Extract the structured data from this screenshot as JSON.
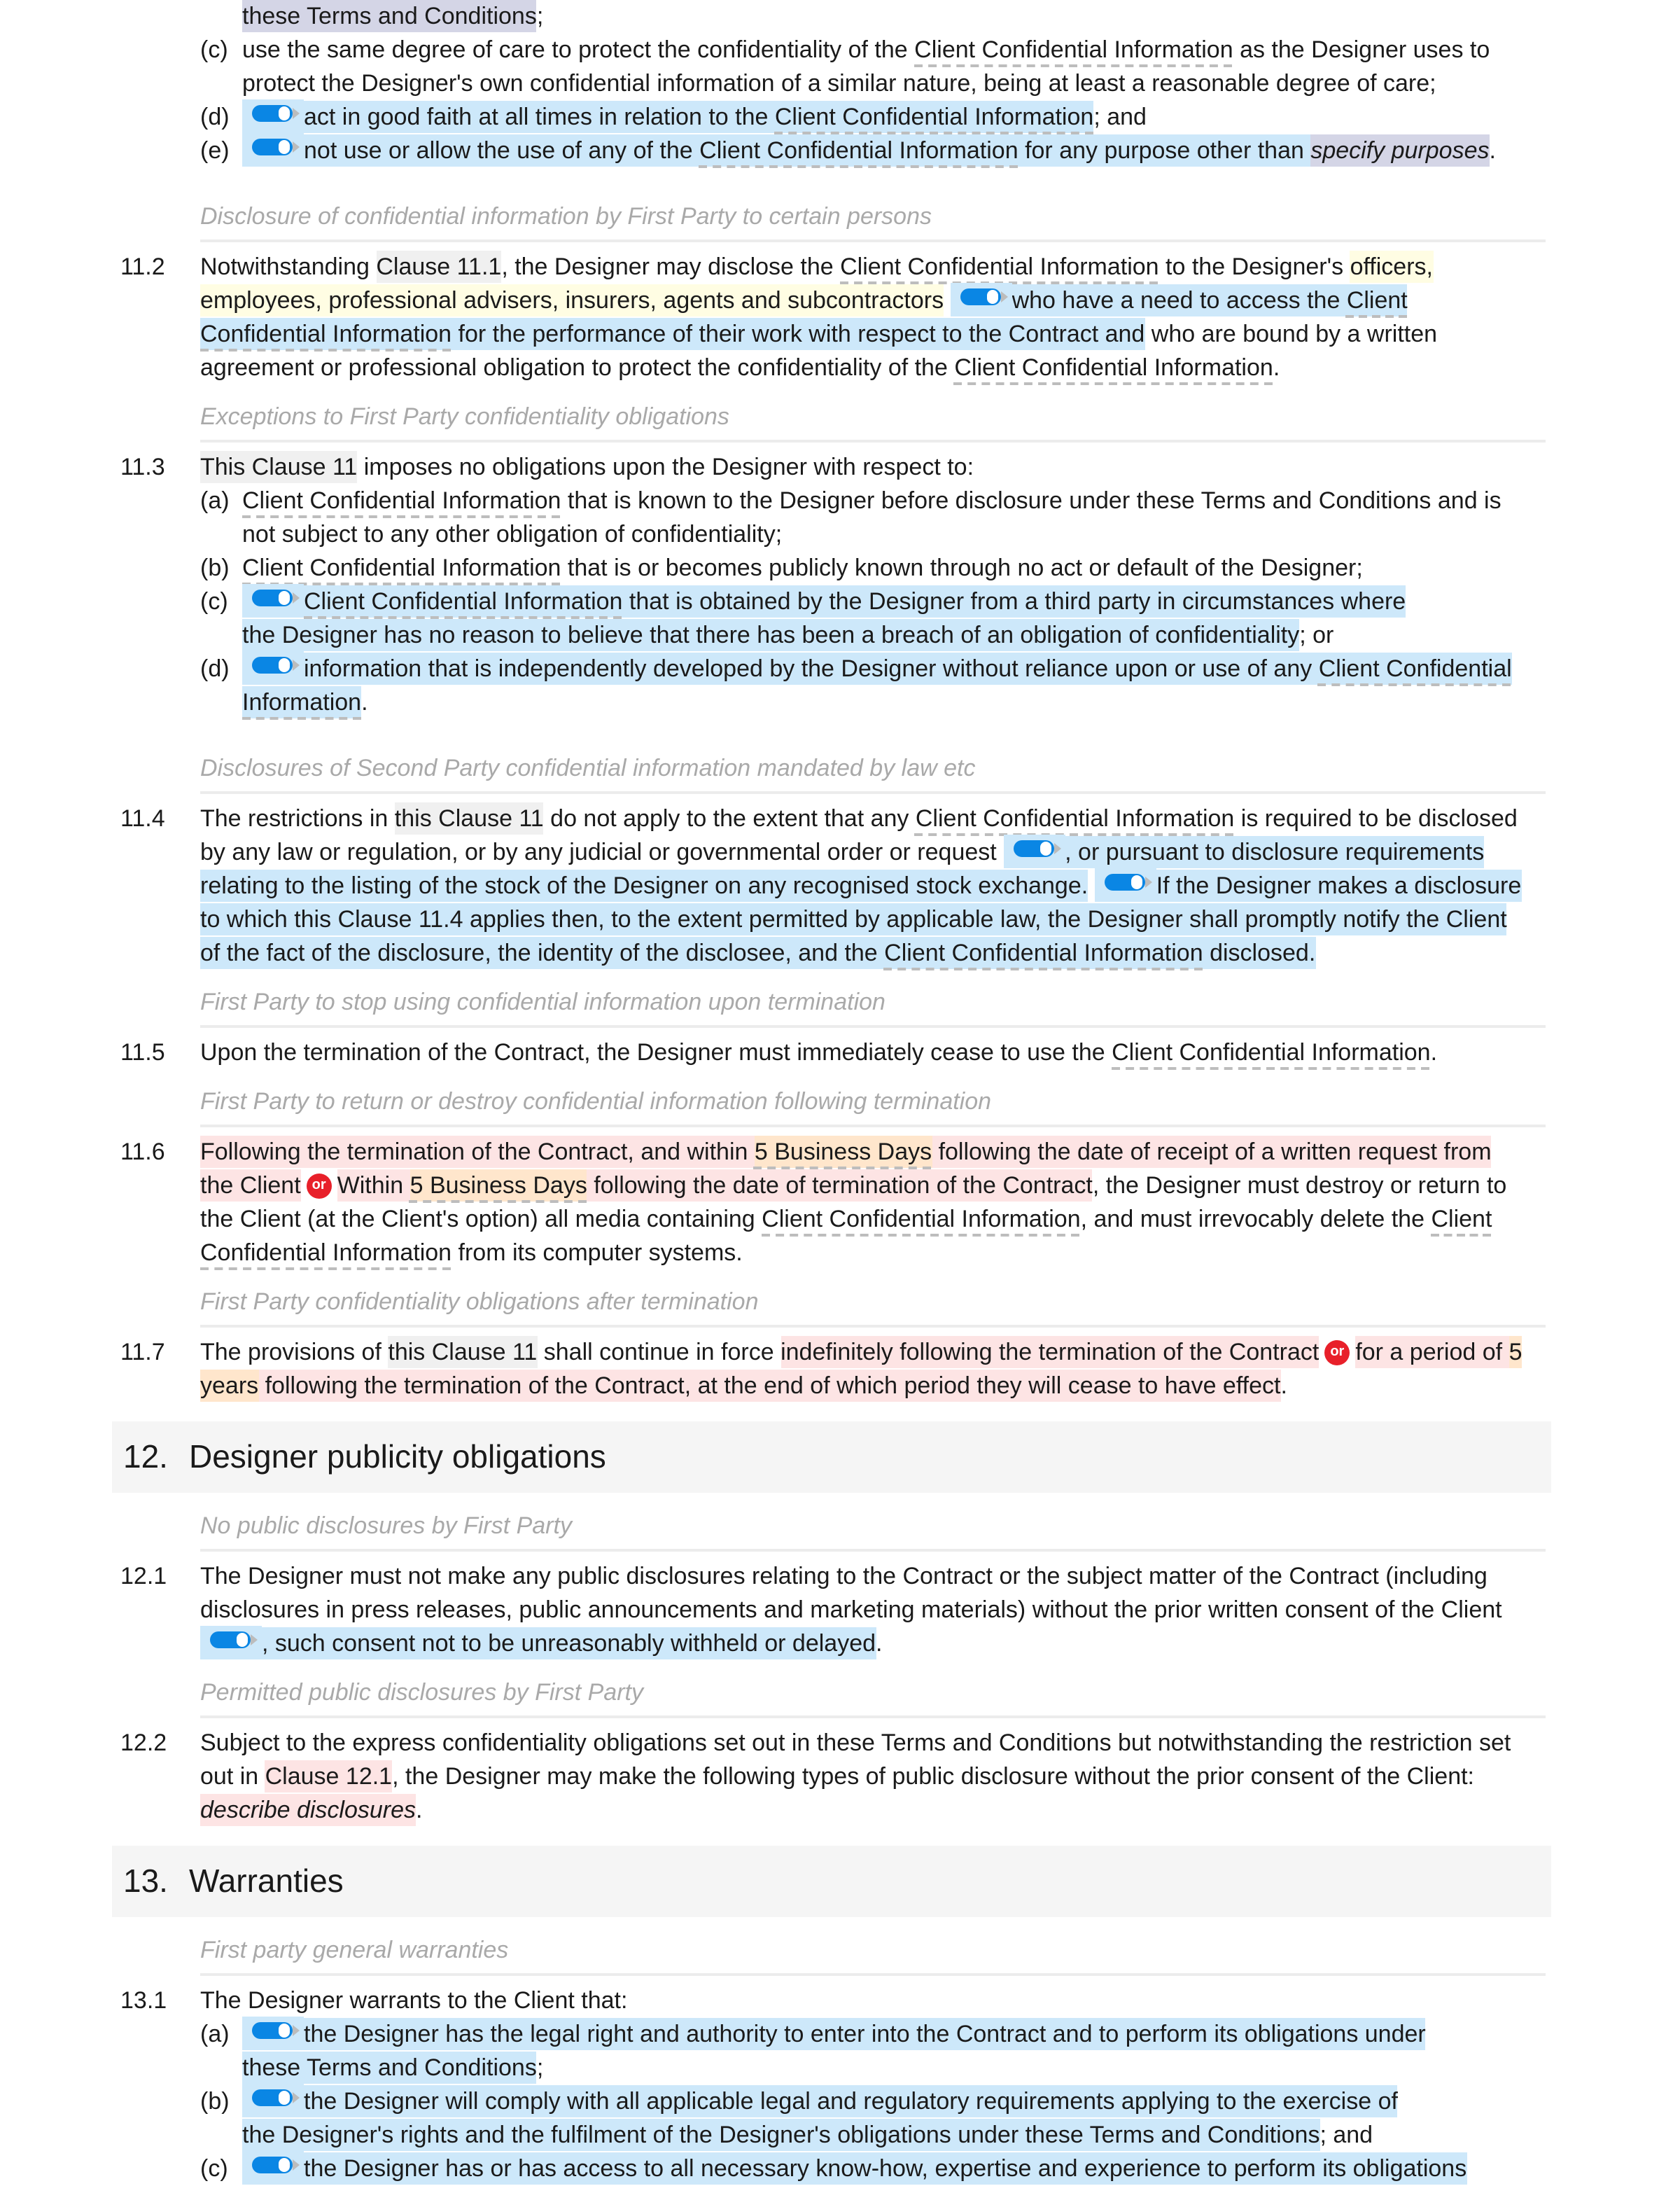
{
  "colors": {
    "toggle": "#0a86e4",
    "option_highlight": "#cde8fa",
    "alternative_highlight": "#fde4e4",
    "variable_highlight": "#ffe6cc",
    "or_badge": "#e8202a"
  },
  "blocks": [
    {
      "type": "sub",
      "label": "",
      "lines": [
        [
          {
            "t": "these Terms and Conditions",
            "c": "v"
          },
          {
            "t": ";"
          }
        ]
      ]
    },
    {
      "type": "sub",
      "label": "(c)",
      "lines": [
        [
          {
            "t": "use the same degree of care to protect the confidentiality of the "
          },
          {
            "t": "Client Confidential Information",
            "c": "d"
          },
          {
            "t": " as the Designer uses to"
          }
        ],
        [
          {
            "t": "protect the Designer's own confidential information of a similar nature, being at least a reasonable degree of care;"
          }
        ]
      ]
    },
    {
      "type": "sub",
      "label": "(d)",
      "lines": [
        [
          {
            "i": "toggle",
            "c": "b"
          },
          {
            "t": "act in good faith at all times in relation to the ",
            "c": "b"
          },
          {
            "t": "Client Confidential Information",
            "c": "b d"
          },
          {
            "t": "; and"
          }
        ]
      ]
    },
    {
      "type": "sub",
      "label": "(e)",
      "lines": [
        [
          {
            "i": "toggle",
            "c": "b"
          },
          {
            "t": "not use or allow the use of any of the ",
            "c": "b"
          },
          {
            "t": "Client Confidential Information",
            "c": "b d"
          },
          {
            "t": " for any purpose other than ",
            "c": "b"
          },
          {
            "t": "specify purposes",
            "c": "v i"
          },
          {
            "t": "."
          }
        ]
      ]
    },
    {
      "type": "heading",
      "text": "Disclosure of confidential information by First Party to certain persons"
    },
    {
      "type": "clause",
      "num": "11.2",
      "lines": [
        [
          {
            "t": "Notwithstanding "
          },
          {
            "t": "Clause 11.1",
            "c": "g"
          },
          {
            "t": ", the Designer may disclose the "
          },
          {
            "t": "Client Confidential Information",
            "c": "d"
          },
          {
            "t": " to the Designer's "
          },
          {
            "t": "officers,",
            "c": "y"
          }
        ],
        [
          {
            "t": "employees, professional advisers, insurers, agents and subcontractors",
            "c": "y"
          },
          {
            "t": " "
          },
          {
            "i": "toggle",
            "c": "b"
          },
          {
            "t": "who have a need to access the ",
            "c": "b"
          },
          {
            "t": "Client",
            "c": "b d"
          }
        ],
        [
          {
            "t": "Confidential Information",
            "c": "b d"
          },
          {
            "t": " for the performance of their work with respect to the Contract and",
            "c": "b"
          },
          {
            "t": " who are bound by a written"
          }
        ],
        [
          {
            "t": "agreement or professional obligation to protect the confidentiality of the "
          },
          {
            "t": "Client Confidential Information",
            "c": "d"
          },
          {
            "t": "."
          }
        ]
      ]
    },
    {
      "type": "heading",
      "text": "Exceptions to First Party confidentiality obligations"
    },
    {
      "type": "clause",
      "num": "11.3",
      "lines": [
        [
          {
            "t": "This Clause 11",
            "c": "g"
          },
          {
            "t": " imposes no obligations upon the Designer with respect to:"
          }
        ]
      ]
    },
    {
      "type": "sub",
      "label": "(a)",
      "lines": [
        [
          {
            "t": "Client Confidential Information",
            "c": "d"
          },
          {
            "t": " that is known to the Designer before disclosure under these Terms and Conditions and is"
          }
        ],
        [
          {
            "t": "not subject to any other obligation of confidentiality;"
          }
        ]
      ]
    },
    {
      "type": "sub",
      "label": "(b)",
      "lines": [
        [
          {
            "t": "Client Confidential Information",
            "c": "d"
          },
          {
            "t": " that is or becomes publicly known through no act or default of the Designer;"
          }
        ]
      ]
    },
    {
      "type": "sub",
      "label": "(c)",
      "lines": [
        [
          {
            "i": "toggle",
            "c": "b"
          },
          {
            "t": "Client Confidential Information",
            "c": "b d"
          },
          {
            "t": " that is obtained by the Designer from a third party in circumstances where",
            "c": "b"
          }
        ],
        [
          {
            "t": "the Designer has no reason to believe that there has been a breach of an obligation of confidentiality",
            "c": "b"
          },
          {
            "t": "; or"
          }
        ]
      ]
    },
    {
      "type": "sub",
      "label": "(d)",
      "lines": [
        [
          {
            "i": "toggle",
            "c": "b"
          },
          {
            "t": "information that is independently developed by the Designer without reliance upon or use of any ",
            "c": "b"
          },
          {
            "t": "Client Confidential",
            "c": "b d"
          }
        ],
        [
          {
            "t": "Information",
            "c": "b d"
          },
          {
            "t": "."
          }
        ]
      ]
    },
    {
      "type": "heading",
      "text": "Disclosures of Second Party confidential information mandated by law etc"
    },
    {
      "type": "clause",
      "num": "11.4",
      "lines": [
        [
          {
            "t": "The restrictions in "
          },
          {
            "t": "this Clause 11",
            "c": "g"
          },
          {
            "t": " do not apply to the extent that any "
          },
          {
            "t": "Client Confidential Information",
            "c": "d"
          },
          {
            "t": " is required to be disclosed"
          }
        ],
        [
          {
            "t": "by any law or regulation, or by any judicial or governmental order or request "
          },
          {
            "i": "toggle",
            "c": "b"
          },
          {
            "t": ", or pursuant to disclosure requirements",
            "c": "b"
          }
        ],
        [
          {
            "t": "relating to the listing of the stock of the Designer on any recognised stock exchange.",
            "c": "b"
          },
          {
            "t": " "
          },
          {
            "i": "toggle",
            "c": "b"
          },
          {
            "t": "If the Designer makes a disclosure",
            "c": "b"
          }
        ],
        [
          {
            "t": "to which ",
            "c": "b"
          },
          {
            "t": "this Clause 11.4",
            "c": "b"
          },
          {
            "t": " applies then, to the extent permitted by applicable law, the Designer shall promptly notify the Client",
            "c": "b"
          }
        ],
        [
          {
            "t": "of the fact of the disclosure, the identity of the disclosee, and the ",
            "c": "b"
          },
          {
            "t": "Client Confidential Information",
            "c": "b d"
          },
          {
            "t": " disclosed.",
            "c": "b"
          }
        ]
      ]
    },
    {
      "type": "heading",
      "text": "First Party to stop using confidential information upon termination"
    },
    {
      "type": "clause",
      "num": "11.5",
      "lines": [
        [
          {
            "t": "Upon the termination of the Contract, the Designer must immediately cease to use the "
          },
          {
            "t": "Client Confidential Information",
            "c": "d"
          },
          {
            "t": "."
          }
        ]
      ]
    },
    {
      "type": "heading",
      "text": "First Party to return or destroy confidential information following termination"
    },
    {
      "type": "clause",
      "num": "11.6",
      "lines": [
        [
          {
            "t": "Following the termination of the Contract, and within ",
            "c": "p"
          },
          {
            "t": "5 Business Days",
            "c": "o d"
          },
          {
            "t": " following the date of receipt of a written request from",
            "c": "p"
          }
        ],
        [
          {
            "t": "the Client",
            "c": "p"
          },
          {
            "i": "or",
            "t": "or"
          },
          {
            "t": "Within ",
            "c": "p"
          },
          {
            "t": "5 Business Days",
            "c": "o d"
          },
          {
            "t": " following the date of termination of the Contract",
            "c": "p"
          },
          {
            "t": ", the Designer must destroy or return to"
          }
        ],
        [
          {
            "t": "the Client (at the Client's option) all media containing "
          },
          {
            "t": "Client Confidential Information",
            "c": "d"
          },
          {
            "t": ", and must irrevocably delete the "
          },
          {
            "t": "Client",
            "c": "d"
          }
        ],
        [
          {
            "t": "Confidential Information",
            "c": "d"
          },
          {
            "t": " from its computer systems."
          }
        ]
      ]
    },
    {
      "type": "heading",
      "text": "First Party confidentiality obligations after termination"
    },
    {
      "type": "clause",
      "num": "11.7",
      "lines": [
        [
          {
            "t": "The provisions of "
          },
          {
            "t": "this Clause 11",
            "c": "g"
          },
          {
            "t": " shall continue in force "
          },
          {
            "t": "indefinitely following the termination of the Contract",
            "c": "p"
          },
          {
            "i": "or",
            "t": "or"
          },
          {
            "t": "for a period of ",
            "c": "p"
          },
          {
            "t": "5",
            "c": "o"
          }
        ],
        [
          {
            "t": "years",
            "c": "o"
          },
          {
            "t": " following the termination of the Contract, at the end of which period they will cease to have effect",
            "c": "p"
          },
          {
            "t": "."
          }
        ]
      ]
    },
    {
      "type": "section",
      "num": "12.",
      "title": "Designer publicity obligations"
    },
    {
      "type": "heading",
      "text": "No public disclosures by First Party"
    },
    {
      "type": "clause",
      "num": "12.1",
      "lines": [
        [
          {
            "t": "The Designer must not make any public disclosures relating to the Contract or the subject matter of the Contract (including"
          }
        ],
        [
          {
            "t": "disclosures in press releases, public announcements and marketing materials) without the prior written consent of the Client"
          }
        ],
        [
          {
            "i": "toggle",
            "c": "b"
          },
          {
            "t": ", such consent not to be unreasonably withheld or delayed",
            "c": "b"
          },
          {
            "t": "."
          }
        ]
      ]
    },
    {
      "type": "heading",
      "text": "Permitted public disclosures by First Party"
    },
    {
      "type": "clause",
      "num": "12.2",
      "lines": [
        [
          {
            "t": "Subject to the express confidentiality obligations set out in these Terms and Conditions but notwithstanding the restriction set"
          }
        ],
        [
          {
            "t": "out in "
          },
          {
            "t": "Clause 12.1",
            "c": "p"
          },
          {
            "t": ", the Designer may make the following types of public disclosure without the prior consent of the Client:"
          }
        ],
        [
          {
            "t": "describe disclosures",
            "c": "p i"
          },
          {
            "t": "."
          }
        ]
      ]
    },
    {
      "type": "section",
      "num": "13.",
      "title": "Warranties"
    },
    {
      "type": "heading",
      "text": "First party general warranties"
    },
    {
      "type": "clause",
      "num": "13.1",
      "lines": [
        [
          {
            "t": "The Designer warrants to the Client that:"
          }
        ]
      ]
    },
    {
      "type": "sub",
      "label": "(a)",
      "lines": [
        [
          {
            "i": "toggle",
            "c": "b"
          },
          {
            "t": "the Designer has the legal right and authority to enter into the Contract and to perform its obligations under",
            "c": "b"
          }
        ],
        [
          {
            "t": "these Terms and Conditions",
            "c": "b"
          },
          {
            "t": ";"
          }
        ]
      ]
    },
    {
      "type": "sub",
      "label": "(b)",
      "lines": [
        [
          {
            "i": "toggle",
            "c": "b"
          },
          {
            "t": "the Designer will comply with all applicable legal and regulatory requirements applying to the exercise of",
            "c": "b"
          }
        ],
        [
          {
            "t": "the Designer's rights and the fulfilment of the Designer's obligations under these Terms and Conditions",
            "c": "b"
          },
          {
            "t": "; and"
          }
        ]
      ]
    },
    {
      "type": "sub",
      "label": "(c)",
      "lines": [
        [
          {
            "i": "toggle",
            "c": "b"
          },
          {
            "t": "the Designer has or has access to all necessary know-how, expertise and experience to perform its obligations",
            "c": "b"
          }
        ]
      ]
    }
  ]
}
